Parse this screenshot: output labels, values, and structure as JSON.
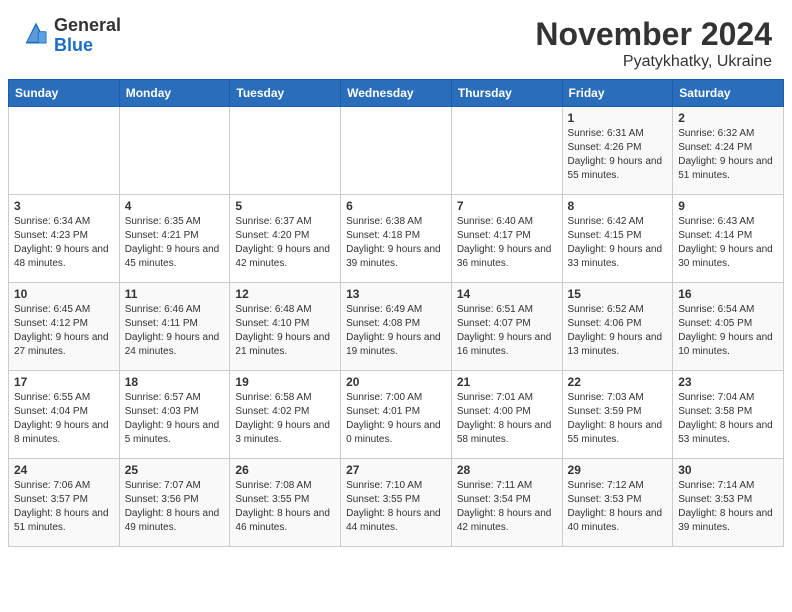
{
  "header": {
    "logo": {
      "general": "General",
      "blue": "Blue"
    },
    "title": "November 2024",
    "location": "Pyatykhatky, Ukraine"
  },
  "calendar": {
    "columns": [
      "Sunday",
      "Monday",
      "Tuesday",
      "Wednesday",
      "Thursday",
      "Friday",
      "Saturday"
    ],
    "weeks": [
      [
        {
          "day": "",
          "info": ""
        },
        {
          "day": "",
          "info": ""
        },
        {
          "day": "",
          "info": ""
        },
        {
          "day": "",
          "info": ""
        },
        {
          "day": "",
          "info": ""
        },
        {
          "day": "1",
          "info": "Sunrise: 6:31 AM\nSunset: 4:26 PM\nDaylight: 9 hours and 55 minutes."
        },
        {
          "day": "2",
          "info": "Sunrise: 6:32 AM\nSunset: 4:24 PM\nDaylight: 9 hours and 51 minutes."
        }
      ],
      [
        {
          "day": "3",
          "info": "Sunrise: 6:34 AM\nSunset: 4:23 PM\nDaylight: 9 hours and 48 minutes."
        },
        {
          "day": "4",
          "info": "Sunrise: 6:35 AM\nSunset: 4:21 PM\nDaylight: 9 hours and 45 minutes."
        },
        {
          "day": "5",
          "info": "Sunrise: 6:37 AM\nSunset: 4:20 PM\nDaylight: 9 hours and 42 minutes."
        },
        {
          "day": "6",
          "info": "Sunrise: 6:38 AM\nSunset: 4:18 PM\nDaylight: 9 hours and 39 minutes."
        },
        {
          "day": "7",
          "info": "Sunrise: 6:40 AM\nSunset: 4:17 PM\nDaylight: 9 hours and 36 minutes."
        },
        {
          "day": "8",
          "info": "Sunrise: 6:42 AM\nSunset: 4:15 PM\nDaylight: 9 hours and 33 minutes."
        },
        {
          "day": "9",
          "info": "Sunrise: 6:43 AM\nSunset: 4:14 PM\nDaylight: 9 hours and 30 minutes."
        }
      ],
      [
        {
          "day": "10",
          "info": "Sunrise: 6:45 AM\nSunset: 4:12 PM\nDaylight: 9 hours and 27 minutes."
        },
        {
          "day": "11",
          "info": "Sunrise: 6:46 AM\nSunset: 4:11 PM\nDaylight: 9 hours and 24 minutes."
        },
        {
          "day": "12",
          "info": "Sunrise: 6:48 AM\nSunset: 4:10 PM\nDaylight: 9 hours and 21 minutes."
        },
        {
          "day": "13",
          "info": "Sunrise: 6:49 AM\nSunset: 4:08 PM\nDaylight: 9 hours and 19 minutes."
        },
        {
          "day": "14",
          "info": "Sunrise: 6:51 AM\nSunset: 4:07 PM\nDaylight: 9 hours and 16 minutes."
        },
        {
          "day": "15",
          "info": "Sunrise: 6:52 AM\nSunset: 4:06 PM\nDaylight: 9 hours and 13 minutes."
        },
        {
          "day": "16",
          "info": "Sunrise: 6:54 AM\nSunset: 4:05 PM\nDaylight: 9 hours and 10 minutes."
        }
      ],
      [
        {
          "day": "17",
          "info": "Sunrise: 6:55 AM\nSunset: 4:04 PM\nDaylight: 9 hours and 8 minutes."
        },
        {
          "day": "18",
          "info": "Sunrise: 6:57 AM\nSunset: 4:03 PM\nDaylight: 9 hours and 5 minutes."
        },
        {
          "day": "19",
          "info": "Sunrise: 6:58 AM\nSunset: 4:02 PM\nDaylight: 9 hours and 3 minutes."
        },
        {
          "day": "20",
          "info": "Sunrise: 7:00 AM\nSunset: 4:01 PM\nDaylight: 9 hours and 0 minutes."
        },
        {
          "day": "21",
          "info": "Sunrise: 7:01 AM\nSunset: 4:00 PM\nDaylight: 8 hours and 58 minutes."
        },
        {
          "day": "22",
          "info": "Sunrise: 7:03 AM\nSunset: 3:59 PM\nDaylight: 8 hours and 55 minutes."
        },
        {
          "day": "23",
          "info": "Sunrise: 7:04 AM\nSunset: 3:58 PM\nDaylight: 8 hours and 53 minutes."
        }
      ],
      [
        {
          "day": "24",
          "info": "Sunrise: 7:06 AM\nSunset: 3:57 PM\nDaylight: 8 hours and 51 minutes."
        },
        {
          "day": "25",
          "info": "Sunrise: 7:07 AM\nSunset: 3:56 PM\nDaylight: 8 hours and 49 minutes."
        },
        {
          "day": "26",
          "info": "Sunrise: 7:08 AM\nSunset: 3:55 PM\nDaylight: 8 hours and 46 minutes."
        },
        {
          "day": "27",
          "info": "Sunrise: 7:10 AM\nSunset: 3:55 PM\nDaylight: 8 hours and 44 minutes."
        },
        {
          "day": "28",
          "info": "Sunrise: 7:11 AM\nSunset: 3:54 PM\nDaylight: 8 hours and 42 minutes."
        },
        {
          "day": "29",
          "info": "Sunrise: 7:12 AM\nSunset: 3:53 PM\nDaylight: 8 hours and 40 minutes."
        },
        {
          "day": "30",
          "info": "Sunrise: 7:14 AM\nSunset: 3:53 PM\nDaylight: 8 hours and 39 minutes."
        }
      ]
    ]
  }
}
